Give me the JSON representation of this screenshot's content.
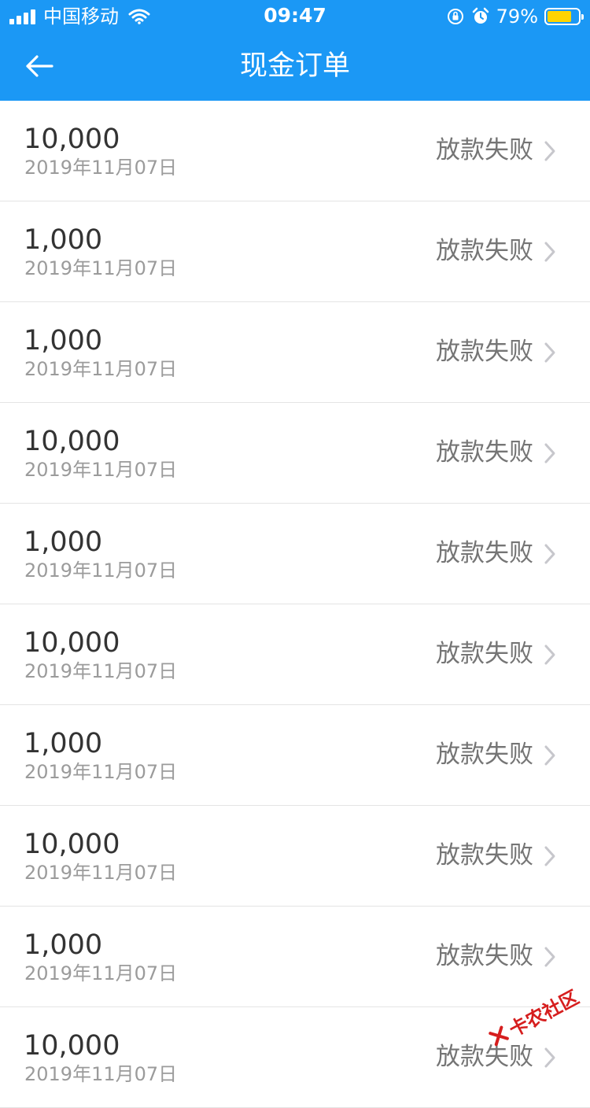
{
  "status_bar": {
    "carrier": "中国移动",
    "time": "09:47",
    "battery_percent": "79%",
    "battery_level": 0.79,
    "battery_color": "#ffd400"
  },
  "nav": {
    "title": "现金订单",
    "back_icon": "arrow-left-icon",
    "bar_color": "#1b98f5"
  },
  "orders": [
    {
      "amount": "10,000",
      "date": "2019年11月07日",
      "status": "放款失败"
    },
    {
      "amount": "1,000",
      "date": "2019年11月07日",
      "status": "放款失败"
    },
    {
      "amount": "1,000",
      "date": "2019年11月07日",
      "status": "放款失败"
    },
    {
      "amount": "10,000",
      "date": "2019年11月07日",
      "status": "放款失败"
    },
    {
      "amount": "1,000",
      "date": "2019年11月07日",
      "status": "放款失败"
    },
    {
      "amount": "10,000",
      "date": "2019年11月07日",
      "status": "放款失败"
    },
    {
      "amount": "1,000",
      "date": "2019年11月07日",
      "status": "放款失败"
    },
    {
      "amount": "10,000",
      "date": "2019年11月07日",
      "status": "放款失败"
    },
    {
      "amount": "1,000",
      "date": "2019年11月07日",
      "status": "放款失败"
    },
    {
      "amount": "10,000",
      "date": "2019年11月07日",
      "status": "放款失败"
    }
  ],
  "watermark": {
    "text": "卡农社区"
  }
}
